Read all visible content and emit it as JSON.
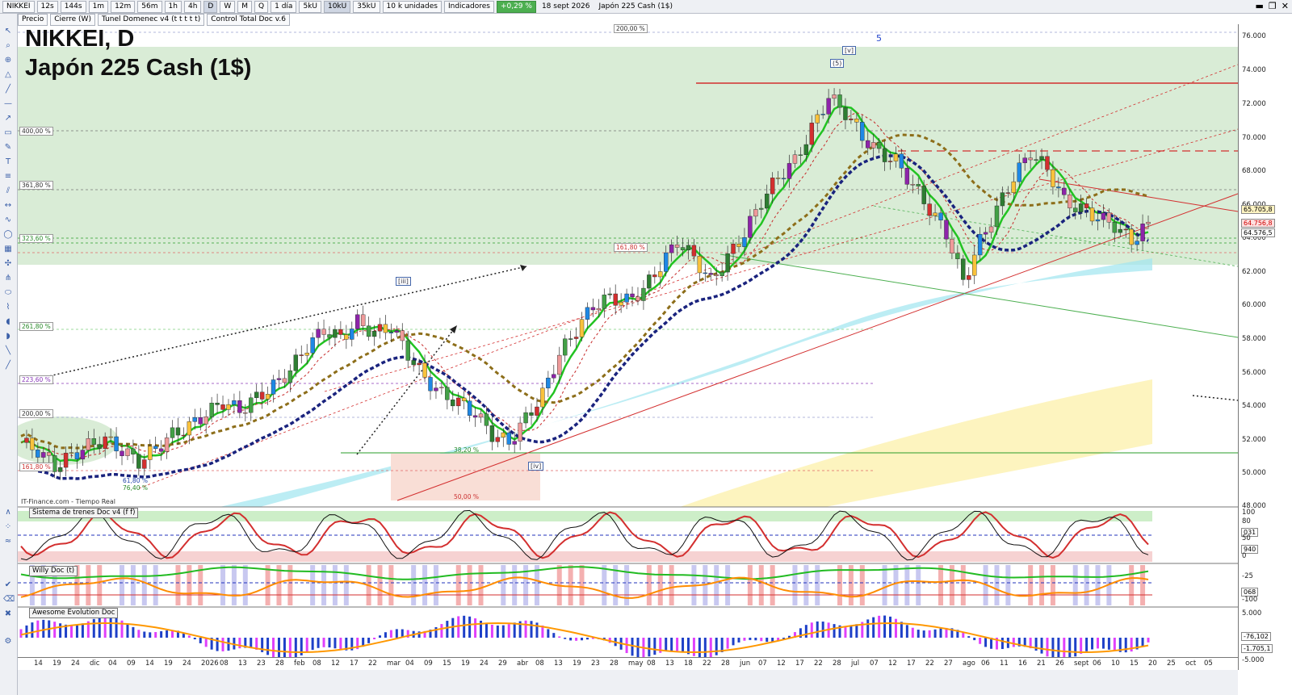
{
  "toolbar": {
    "symbol": "NIKKEI",
    "timeframes": [
      "12s",
      "144s",
      "1m",
      "12m",
      "56m",
      "1h",
      "4h",
      "D",
      "W",
      "M",
      "Q"
    ],
    "period": "1 día",
    "units": [
      "5kU",
      "10kU",
      "35kU"
    ],
    "units_select": "10 k unidades",
    "indicators": "Indicadores",
    "change": "+0,29 %",
    "date": "18 sept 2026",
    "instrument": "Japón 225 Cash (1$)"
  },
  "legend": {
    "precio": "Precio",
    "cierre": "Cierre (W)",
    "tunel": "Tunel Domenec v4 (t t t t t)",
    "control": "Control Total Doc v.6"
  },
  "title": {
    "line1": "NIKKEI, D",
    "line2": "Japón 225 Cash (1$)"
  },
  "watermark": "IT-Finance.com - Tiempo Real",
  "fib_labels": [
    {
      "text": "200,00 %"
    },
    {
      "text": "400,00 %"
    },
    {
      "text": "361,80 %"
    },
    {
      "text": "323,60 %"
    },
    {
      "text": "261,80 %"
    },
    {
      "text": "223,60 %"
    },
    {
      "text": "200,00 %"
    },
    {
      "text": "161,80 %"
    },
    {
      "text": "161,80 %"
    },
    {
      "text": "38,20 %"
    },
    {
      "text": "50,00 %"
    },
    {
      "text": "61,80 %"
    },
    {
      "text": "76,40 %"
    }
  ],
  "wave_labels": [
    "[iii]",
    "[iv]",
    "(5)",
    "[v]",
    "5"
  ],
  "price_axis": [
    "76.000",
    "74.000",
    "72.000",
    "70.000",
    "68.000",
    "66.000",
    "64.000",
    "62.000",
    "60.000",
    "58.000",
    "56.000",
    "54.000",
    "52.000",
    "50.000",
    "48.000"
  ],
  "price_tags": [
    "65.705,8",
    "64.756,8",
    "64.576,5"
  ],
  "date_axis": [
    "14",
    "19",
    "24",
    "dic",
    "04",
    "09",
    "14",
    "19",
    "24",
    "2026",
    "08",
    "13",
    "23",
    "28",
    "feb",
    "08",
    "12",
    "17",
    "22",
    "mar",
    "04",
    "09",
    "15",
    "19",
    "24",
    "29",
    "abr",
    "08",
    "13",
    "19",
    "23",
    "28",
    "may",
    "08",
    "13",
    "18",
    "22",
    "28",
    "jun",
    "07",
    "12",
    "17",
    "22",
    "28",
    "jul",
    "07",
    "12",
    "17",
    "22",
    "27",
    "ago",
    "06",
    "11",
    "16",
    "21",
    "26",
    "sept",
    "06",
    "10",
    "15",
    "20",
    "25",
    "oct",
    "05"
  ],
  "panels": {
    "trenes": {
      "title": "Sistema de trenes Doc v4 (f f)",
      "axis": [
        "100",
        "80",
        "50",
        "20",
        "0"
      ],
      "tags": [
        "031",
        "940"
      ]
    },
    "willy": {
      "title": "Willy Doc (t)",
      "axis": [
        "-25",
        "-75",
        "-100"
      ],
      "tags": [
        "068"
      ]
    },
    "awesome": {
      "title": "Awesome Evolution Doc",
      "axis": [
        "5.000",
        "0",
        "-5.000"
      ],
      "tags": [
        "-76,102",
        "-1.705,1"
      ]
    }
  },
  "chart_data": {
    "type": "candlestick",
    "ylim": [
      47000,
      77000
    ],
    "ohlc_close_approx": [
      51000,
      50500,
      49500,
      50200,
      50800,
      51200,
      50500,
      49800,
      50600,
      51500,
      52000,
      52800,
      53500,
      53000,
      53800,
      54500,
      55500,
      57000,
      58000,
      57500,
      58500,
      57800,
      58200,
      56500,
      55000,
      54000,
      53500,
      52800,
      51500,
      51000,
      52500,
      54000,
      56500,
      58000,
      59500,
      60000,
      59800,
      60500,
      62000,
      63500,
      62500,
      61000,
      62500,
      64000,
      66000,
      67500,
      68500,
      70500,
      72500,
      71500,
      70000,
      69000,
      68500,
      67000,
      65500,
      64000,
      61000,
      63500,
      65500,
      67500,
      69000,
      68000,
      66000,
      65500,
      65000,
      64500,
      63500,
      64700
    ]
  }
}
